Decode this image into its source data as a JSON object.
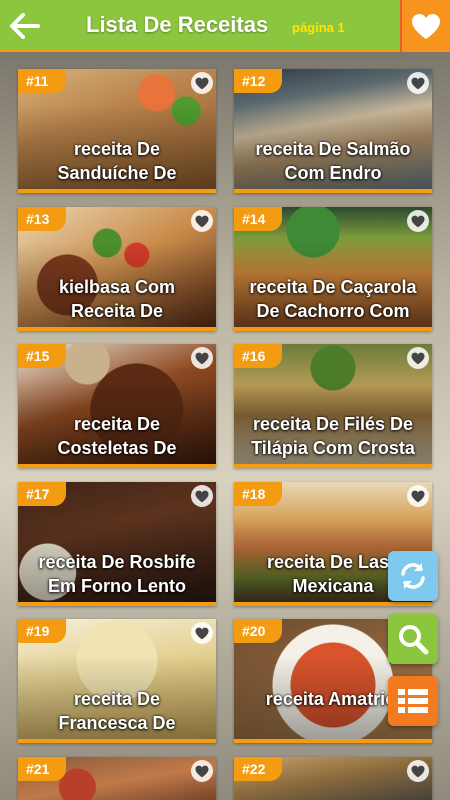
{
  "header": {
    "title": "Lista De Receitas",
    "page_label": "página 1",
    "back_icon": "arrow-left-icon",
    "favorite_icon": "heart-icon"
  },
  "colors": {
    "header_green": "#8cc63f",
    "accent_orange": "#f39c12",
    "refresh_blue": "#7fc9ee",
    "search_green": "#8cc63f",
    "list_orange": "#f47a20"
  },
  "recipes": [
    {
      "number": "#11",
      "title_line1": "receita De",
      "title_line2": "Sanduíche De"
    },
    {
      "number": "#12",
      "title_line1": "receita De Salmão",
      "title_line2": "Com Endro"
    },
    {
      "number": "#13",
      "title_line1": "kielbasa Com",
      "title_line2": "Receita De"
    },
    {
      "number": "#14",
      "title_line1": "receita De Caçarola",
      "title_line2": "De Cachorro Com"
    },
    {
      "number": "#15",
      "title_line1": "receita De",
      "title_line2": "Costeletas De"
    },
    {
      "number": "#16",
      "title_line1": "receita De Filés De",
      "title_line2": "Tilápia Com Crosta"
    },
    {
      "number": "#17",
      "title_line1": "receita De Rosbife",
      "title_line2": "Em Forno Lento"
    },
    {
      "number": "#18",
      "title_line1": "receita De Lasa",
      "title_line2": "Mexicana"
    },
    {
      "number": "#19",
      "title_line1": "receita De",
      "title_line2": "Francesca De"
    },
    {
      "number": "#20",
      "title_line1": "receita Amatrici",
      "title_line2": ""
    },
    {
      "number": "#21",
      "title_line1": "",
      "title_line2": ""
    },
    {
      "number": "#22",
      "title_line1": "",
      "title_line2": ""
    }
  ],
  "actions": {
    "refresh_icon": "refresh-icon",
    "search_icon": "search-icon",
    "list_icon": "list-view-icon"
  }
}
